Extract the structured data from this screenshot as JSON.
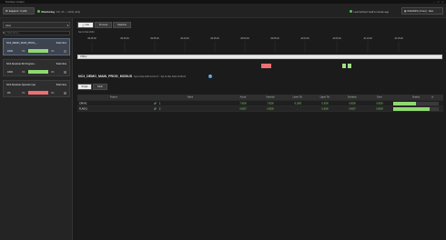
{
  "window": {
    "title": "ProVision Cockpit",
    "controls": [
      "–",
      "□",
      "×"
    ]
  },
  "topbar": {
    "equipment_button": "Equipmt. X (All)",
    "monitoring_label": "Monitoring",
    "monitoring_info": "ON; 4C.../ (dbh) (Hrs)",
    "load_info": "Last fetched: Half a minute ago",
    "date_button": "6/11/2023 (1 hour) - Now"
  },
  "sidebar": {
    "info_label": "Infos",
    "filter_placeholder": "Filter list by...",
    "cards": [
      {
        "name": "NC4_DEMO_MAIN_PROG_...",
        "total": "Total infos",
        "pct": "100%",
        "pz": "0%",
        "pn": "0%",
        "bar": "green",
        "selected": true
      },
      {
        "name": "NC4 Absolute INI Program...",
        "total": "Total infos",
        "pct": "100%",
        "pz": "0%",
        "pn": "0%",
        "bar": "green",
        "selected": false
      },
      {
        "name": "NC4 Absolute Operator (as)",
        "total": "Total infos",
        "pct": "0%",
        "pz": "0%",
        "pn": "0%",
        "bar": "red",
        "selected": false
      }
    ]
  },
  "main": {
    "tabs": [
      "Info",
      "Process",
      "Machine"
    ],
    "date_line": "Sat 11 Mar 2023",
    "time_axis": [
      "09:25:00",
      "09:30:00",
      "09:35:00",
      "09:40:00",
      "09:45:00",
      "09:50:00",
      "09:55:00",
      "10:00:00",
      "10:05:00",
      "10:10:00",
      "10:15:00"
    ],
    "offline_label": "Offline",
    "program_name": "NC4_DEMO_MAIN_PROG_MODUS",
    "program_dates": "Sat 11 Mar 2023 10:01:17 - Sat 11 Mar 2023 10:06:24",
    "info_icon": "i",
    "subtabs": [
      "Single",
      "Multi"
    ],
    "table": {
      "headers": [
        "Feature",
        "Name",
        "Actual",
        "Nominal",
        "Lower Tol.",
        "Upper Tol.",
        "Deviation",
        "Error",
        "Graphic"
      ],
      "rows": [
        {
          "feature": "CIRAX1",
          "name": "1",
          "actual": "7.0000",
          "nominal": "7.0000",
          "lower": "-0.1000",
          "upper": "0.1000",
          "deviation": "0.0000",
          "error": "0.0000",
          "fill": 0.5
        },
        {
          "feature": "FLAEX1",
          "name": "2",
          "actual": "0.0057",
          "nominal": "0.0000",
          "lower": "...",
          "upper": "0.1000",
          "deviation": "0.0057",
          "error": "0.0000",
          "fill": 0.8
        }
      ]
    }
  },
  "colors": {
    "green": "#8fd970",
    "red": "#ee6f73",
    "accent": "#4aa3df",
    "offline": "#e9e9e9"
  }
}
